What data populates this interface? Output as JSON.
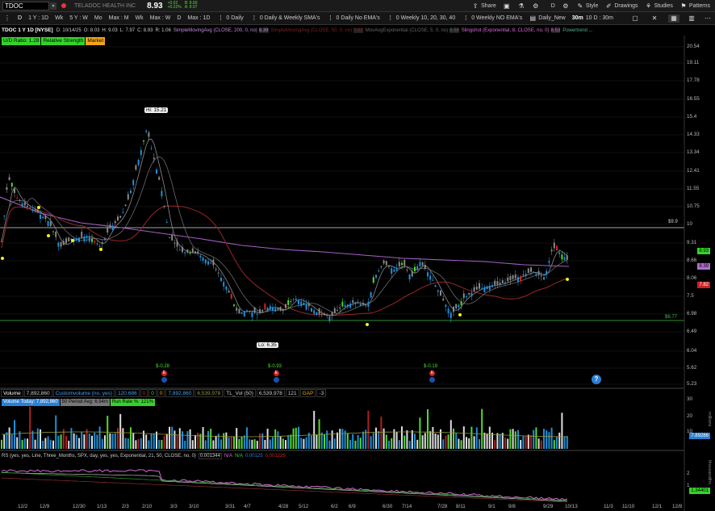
{
  "topbar": {
    "symbol": "TDOC",
    "company": "TELADOC HEALTH INC",
    "last": "8.93",
    "change": "+0.02",
    "change_pct": "+0.22%",
    "bid": "B: 8.89",
    "ask": "A: 8.97",
    "actions": [
      "Share",
      "Style",
      "Drawings",
      "Studies",
      "Patterns"
    ],
    "d_label": "D"
  },
  "toolbar": {
    "items": [
      "D",
      "1 Y : 1D",
      "Wk",
      "5 Y : W",
      "Mo",
      "Max : M",
      "Wk",
      "Max : W",
      "D",
      "Max : 1D",
      "0 Daily",
      "0 Daily & Weekly SMA's",
      "0 Daily No EMA's",
      "0 Weekly 10, 20, 30, 40",
      "0 Weekly NO EMA's",
      "Daily_New",
      "30m",
      "10 D : 30m"
    ]
  },
  "studybar": {
    "title": "TDOC 1 Y 1D [NYSE]",
    "date": "D: 10/14/25",
    "open": "O: 8.03",
    "high": "H: 9.03",
    "low": "L: 7.97",
    "close": "C: 8.93",
    "range": "R: 1.06",
    "sma200": "SimpleMovingAvg (CLOSE, 200, 0, no)",
    "sma200_val": "8.39",
    "sma50": "SimpleMovingAvg (CLOSE, 50, 0, no)",
    "sma50_val": "7.82",
    "ema5": "MovAvgExponential (CLOSE, 5, 0, no)",
    "ema5_val": "8.58",
    "slingshot": "Slingshot (Exponential, 8, CLOSE, no, 0)",
    "slingshot_val": "8.53",
    "powertrend": "Powertrend ..."
  },
  "chips": {
    "ud": "U/D Ratio: 1.28",
    "rel": "Relative Strength",
    "market": "Market"
  },
  "annotations": {
    "hi": "Hi: 15.21",
    "lo": "Lo: 6.35",
    "div1": "$-0.28",
    "div2": "$-0.93",
    "div3": "$-0.19",
    "eq": "E",
    "q": "?",
    "level_top": "$9.9",
    "level_bot": "$6.77"
  },
  "price_tags": {
    "last": "8.93",
    "sma200": "8.39",
    "sma50": "7.82"
  },
  "y_labels": [
    "20.54",
    "19.11",
    "17.78",
    "16.55",
    "15.4",
    "14.33",
    "13.34",
    "12.41",
    "11.55",
    "10.75",
    "10",
    "9.31",
    "8.66",
    "8.06",
    "7.5",
    "6.98",
    "6.49",
    "6.04",
    "5.62",
    "5.23"
  ],
  "x_labels": [
    "12/2",
    "12/9",
    "12/30",
    "1/13",
    "2/3",
    "2/10",
    "3/3",
    "3/10",
    "3/31",
    "4/7",
    "4/28",
    "5/12",
    "6/2",
    "6/9",
    "6/30",
    "7/14",
    "7/28",
    "8/11",
    "9/1",
    "9/8",
    "9/29",
    "10/13",
    "11/3",
    "11/10",
    "12/1",
    "12/8"
  ],
  "volume": {
    "label": "Volume",
    "value": "7,892,860",
    "custom": "Customvolume (no, yes)",
    "custom_val": "120.686",
    "z1": "0",
    "z2": "0",
    "z3": "0",
    "v2": "7,892,860",
    "v3": "6,539,978",
    "tlvol": "TL_Vol (50)",
    "tlvol_val": "6,539,978",
    "n121": "121",
    "gap": "GAP",
    "gap_val": "-3",
    "today": "Volume Today: 7,892,860",
    "avg": "50 Period Avg: 6.54m",
    "runrate": "Run Rate %: 121%",
    "y30": "30",
    "y20": "20",
    "y10": "10",
    "unit": "millions",
    "tag": "7.89286"
  },
  "rs": {
    "label": "RS (yes, yes, Line, Three_Months, SPX, day, yes, yes, Exponential, 21, 50, CLOSE, no, 0)",
    "val1": "0.001344",
    "na1": "N/A",
    "na2": "N/A",
    "val2": "0.00125",
    "val3": "0.001229",
    "y2": "2",
    "y1": "1",
    "tag": "1.34401",
    "unit": "thousandths"
  },
  "colors": {
    "up": "#1f8fd8",
    "down": "#8a8a8a",
    "green": "#4fdc2a",
    "red": "#d22",
    "sma200": "#b06fd0",
    "sma50": "#9b2a2a"
  }
}
